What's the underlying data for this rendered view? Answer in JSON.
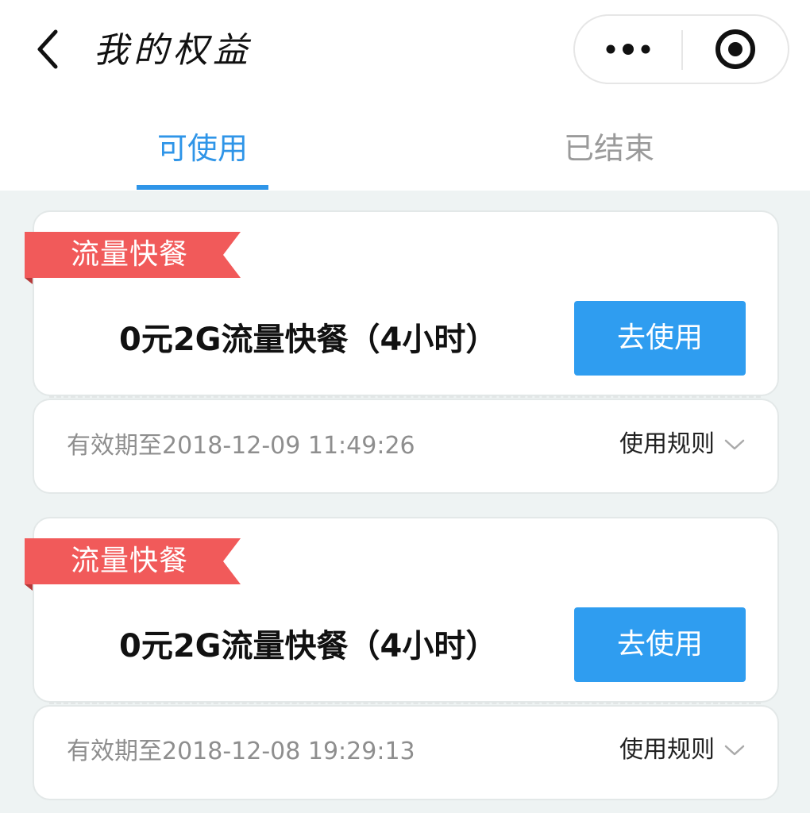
{
  "header": {
    "title": "我的权益",
    "back_icon": "chevron-left-icon",
    "more_icon": "more-dots-icon",
    "close_icon": "target-close-icon"
  },
  "tabs": [
    {
      "label": "可使用",
      "active": true
    },
    {
      "label": "已结束",
      "active": false
    }
  ],
  "colors": {
    "accent": "#2f95e8",
    "button": "#2f9df0",
    "tag": "#f15a5a",
    "background": "#eef3f3"
  },
  "benefits": [
    {
      "tag": "流量快餐",
      "title": "0元2G流量快餐（4小时）",
      "button": "去使用",
      "expiry": "有效期至2018-12-09 11:49:26",
      "rules": "使用规则"
    },
    {
      "tag": "流量快餐",
      "title": "0元2G流量快餐（4小时）",
      "button": "去使用",
      "expiry": "有效期至2018-12-08 19:29:13",
      "rules": "使用规则"
    }
  ]
}
